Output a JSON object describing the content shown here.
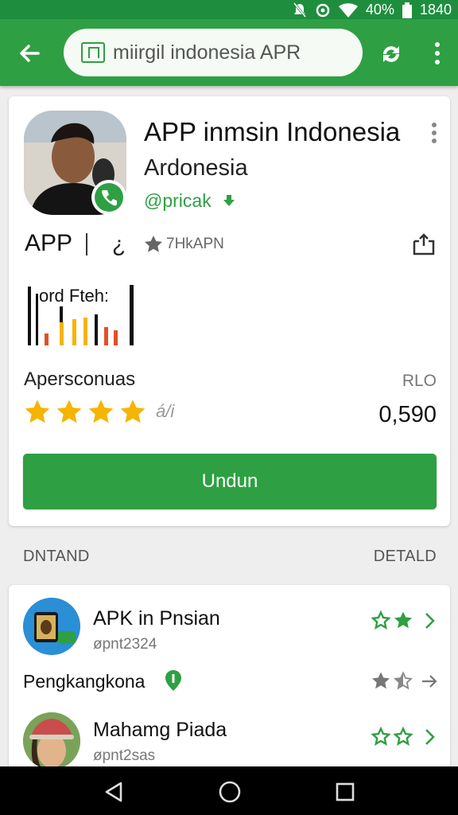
{
  "colors": {
    "brand_green": "#2ea043",
    "status_green": "#1e8e3e",
    "star_yellow": "#f5b400"
  },
  "status_bar": {
    "battery_text": "40%",
    "time": "1840",
    "icons": [
      "notifications-off-icon",
      "sync-icon",
      "wifi-icon",
      "battery-icon"
    ]
  },
  "app_bar": {
    "search_query": "miirgil indonesia APR",
    "icons": [
      "back-arrow-icon",
      "app-square-icon",
      "sync-icon",
      "more-vert-icon"
    ]
  },
  "app_card": {
    "title": "APP inmsin Indonesia",
    "subtitle": "Ardonesia",
    "developer": "@pricak",
    "meta_label": "APP",
    "meta_glyph": "¿",
    "meta_rating_text": "7HkAPN",
    "chart_label": "ord Fteh:",
    "rating_label": "Apersconuas",
    "rating_right_label": "RLO",
    "stars_count": 4,
    "stars_suffix": "á/і",
    "rating_count": "0,590",
    "install_label": "Undun"
  },
  "section": {
    "left_label": "DNTAND",
    "right_label": "DETALD"
  },
  "list": {
    "items": [
      {
        "title": "APK in Pnsian",
        "subtitle": "øpnt2324",
        "stars": "two-outline-filled"
      },
      {
        "label": "Pengkangkona",
        "stars": "gray"
      },
      {
        "title": "Mahamg Piada",
        "subtitle": "øpnt2sas",
        "stars": "two-outline"
      }
    ]
  },
  "nav_bar": {
    "icons": [
      "back-triangle-icon",
      "home-circle-icon",
      "recents-square-icon"
    ]
  }
}
